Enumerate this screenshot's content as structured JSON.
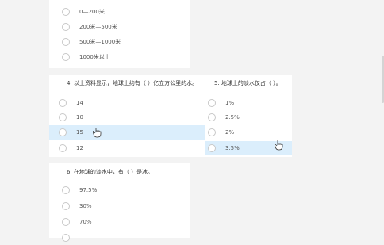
{
  "q3": {
    "options": [
      "0—200米",
      "200米—500米",
      "500米—1000米",
      "1000米以上"
    ]
  },
  "q4": {
    "title": "4. 以上资料显示，地球上约有（    ）亿立方公里的水。",
    "options": [
      "14",
      "10",
      "15",
      "12"
    ],
    "selected_index": 2
  },
  "q5": {
    "title": "5. 地球上的淡水仅占（    ）。",
    "options": [
      "1%",
      "2.5%",
      "2%",
      "3.5%"
    ],
    "selected_index": 3
  },
  "q6": {
    "title": "6. 在地球的淡水中，有（    ）是冰。",
    "options": [
      "97.5%",
      "30%",
      "70%"
    ]
  }
}
